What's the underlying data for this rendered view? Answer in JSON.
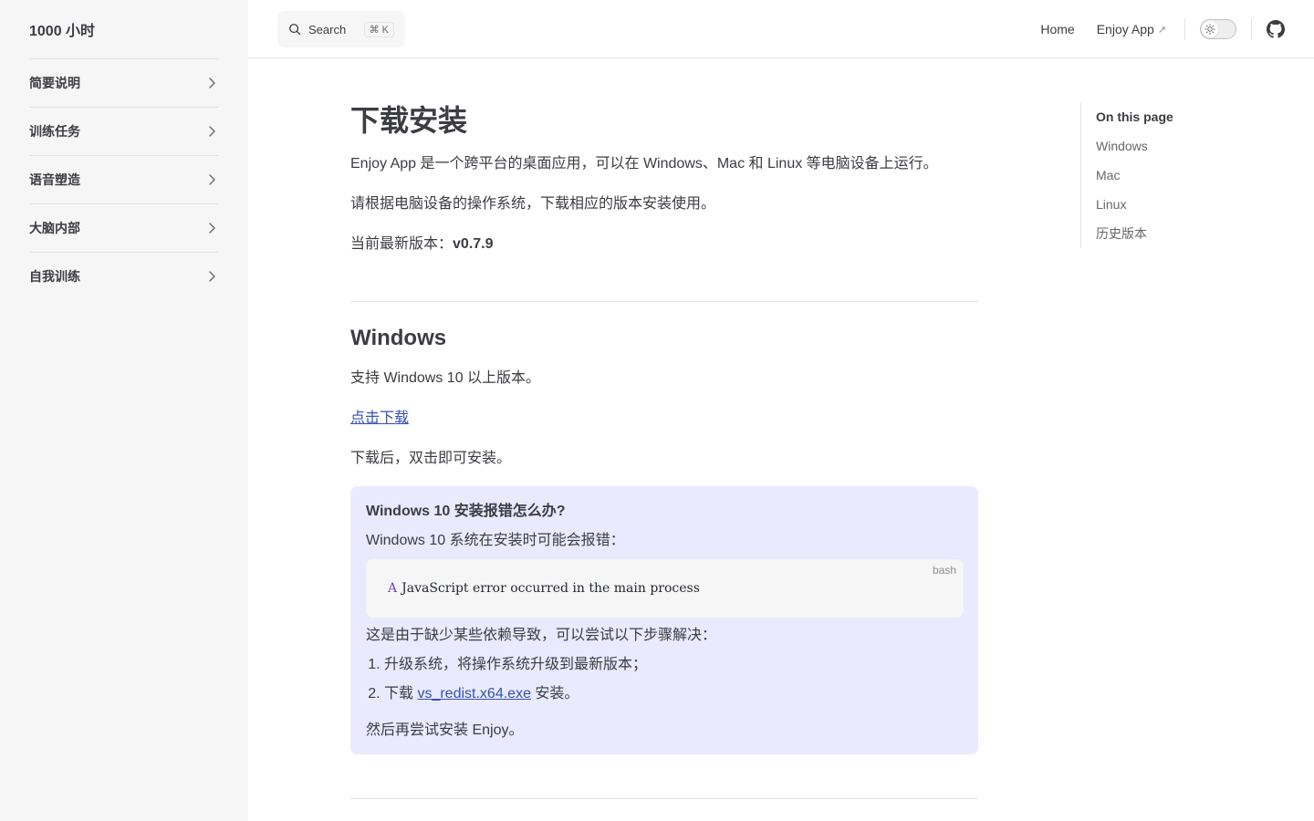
{
  "sidebar": {
    "title": "1000 小时",
    "items": [
      {
        "label": "简要说明"
      },
      {
        "label": "训练任务"
      },
      {
        "label": "语音塑造"
      },
      {
        "label": "大脑内部"
      },
      {
        "label": "自我训练"
      }
    ]
  },
  "topbar": {
    "search_label": "Search",
    "search_shortcut": "⌘ K",
    "nav": [
      {
        "label": "Home"
      },
      {
        "label": "Enjoy App",
        "external": "↗"
      }
    ]
  },
  "main": {
    "title": "下载安装",
    "intro": "Enjoy App 是一个跨平台的桌面应用，可以在 Windows、Mac 和 Linux 等电脑设备上运行。",
    "instruction": "请根据电脑设备的操作系统，下载相应的版本安装使用。",
    "version_label": "当前最新版本：",
    "version": "v0.7.9",
    "windows": {
      "heading": "Windows",
      "support": "支持 Windows 10 以上版本。",
      "download_link": "点击下载",
      "after": "下载后，双击即可安装。",
      "tip": {
        "title": "Windows 10 安装报错怎么办?",
        "desc": "Windows 10 系统在安装时可能会报错：",
        "code_lang": "bash",
        "code_keyword": "A",
        "code_text": "JavaScript error occurred in the main process",
        "cause": "这是由于缺少某些依赖导致，可以尝试以下步骤解决：",
        "step1": "升级系统，将操作系统升级到最新版本；",
        "step2_prefix": "下载 ",
        "step2_link": "vs_redist.x64.exe",
        "step2_suffix": " 安装。",
        "final": "然后再尝试安装 Enjoy。"
      }
    }
  },
  "outline": {
    "title": "On this page",
    "items": [
      {
        "label": "Windows"
      },
      {
        "label": "Mac"
      },
      {
        "label": "Linux"
      },
      {
        "label": "历史版本"
      }
    ]
  },
  "colors": {
    "link": "#3451b2",
    "tip_bg": "#e9eafd",
    "sidebar_bg": "#f6f6f7"
  }
}
